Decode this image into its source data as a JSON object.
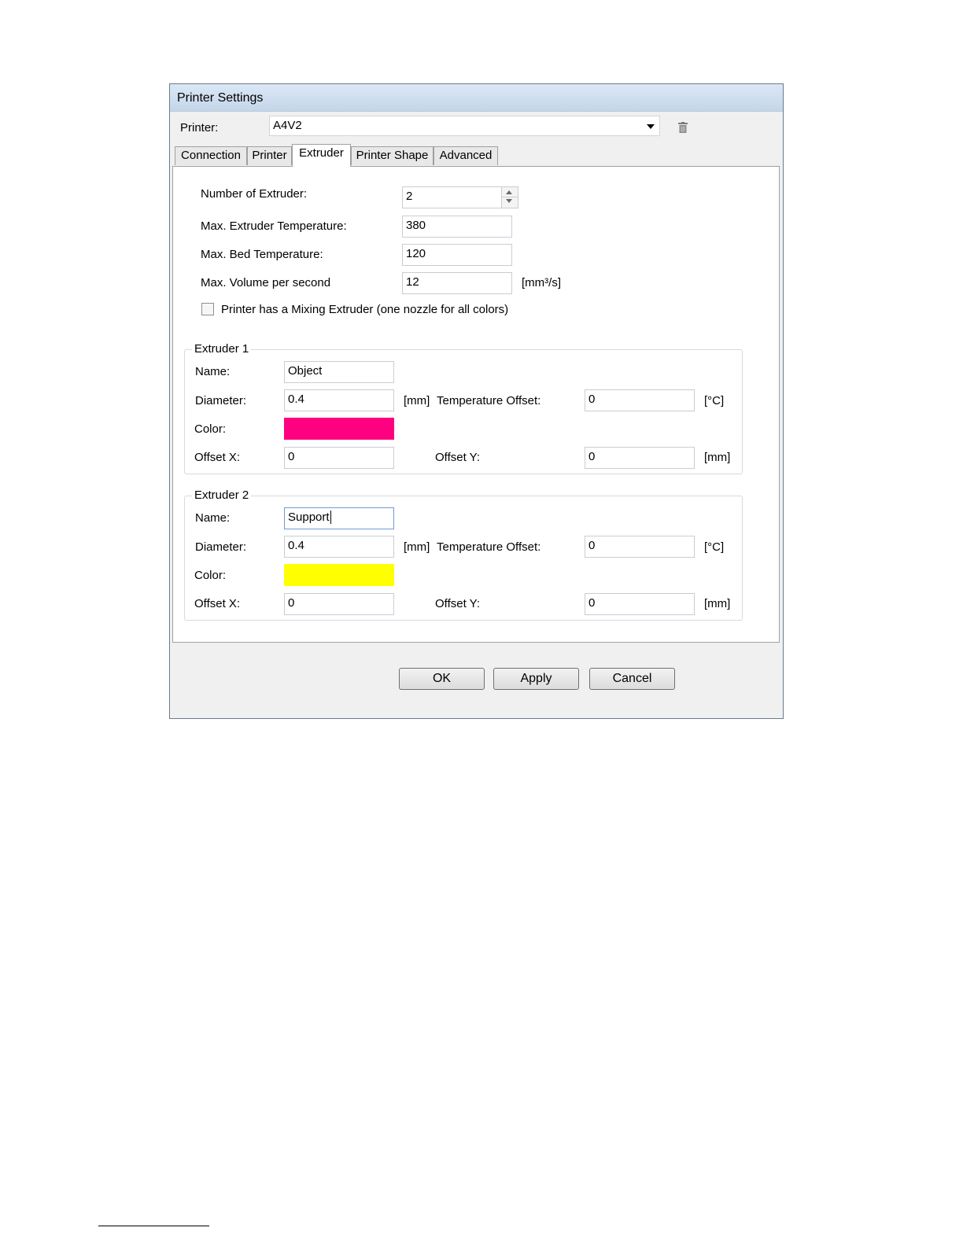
{
  "window": {
    "title": "Printer Settings"
  },
  "printer": {
    "label": "Printer:",
    "value": "A4V2"
  },
  "tabs": [
    {
      "label": "Connection"
    },
    {
      "label": "Printer"
    },
    {
      "label": "Extruder"
    },
    {
      "label": "Printer Shape"
    },
    {
      "label": "Advanced"
    }
  ],
  "active_tab": "Extruder",
  "general": {
    "num_extruder_label": "Number of Extruder:",
    "num_extruder_value": "2",
    "max_extruder_temp_label": "Max. Extruder Temperature:",
    "max_extruder_temp_value": "380",
    "max_bed_temp_label": "Max. Bed Temperature:",
    "max_bed_temp_value": "120",
    "max_volume_label": "Max. Volume per second",
    "max_volume_value": "12",
    "max_volume_unit": "[mm³/s]",
    "mixing_label": "Printer has a Mixing Extruder (one nozzle for all colors)",
    "mixing_checked": false
  },
  "extruders": [
    {
      "title": "Extruder 1",
      "name_label": "Name:",
      "name": "Object",
      "diameter_label": "Diameter:",
      "diameter": "0.4",
      "diameter_unit": "[mm]",
      "temp_offset_label": "Temperature Offset:",
      "temp_offset": "0",
      "temp_unit": "[°C]",
      "color_label": "Color:",
      "color": "#ff0080",
      "offset_x_label": "Offset X:",
      "offset_x": "0",
      "offset_y_label": "Offset Y:",
      "offset_y": "0",
      "offset_unit": "[mm]"
    },
    {
      "title": "Extruder 2",
      "name_label": "Name:",
      "name": "Support",
      "diameter_label": "Diameter:",
      "diameter": "0.4",
      "diameter_unit": "[mm]",
      "temp_offset_label": "Temperature Offset:",
      "temp_offset": "0",
      "temp_unit": "[°C]",
      "color_label": "Color:",
      "color": "#ffff00",
      "offset_x_label": "Offset X:",
      "offset_x": "0",
      "offset_y_label": "Offset Y:",
      "offset_y": "0",
      "offset_unit": "[mm]"
    }
  ],
  "buttons": {
    "ok": "OK",
    "apply": "Apply",
    "cancel": "Cancel"
  }
}
